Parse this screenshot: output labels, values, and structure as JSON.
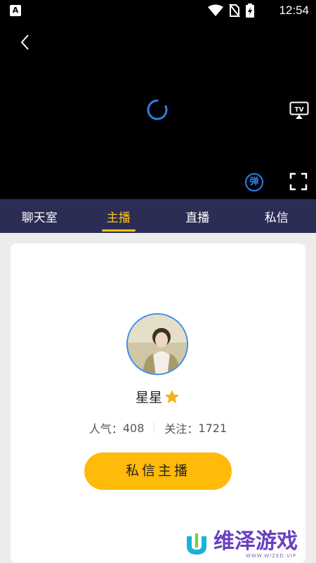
{
  "status_bar": {
    "app_icon_letter": "A",
    "time": "12:54"
  },
  "player": {
    "danmu_label": "弹",
    "tv_label": "TV"
  },
  "tabs": [
    {
      "label": "聊天室",
      "active": false
    },
    {
      "label": "主播",
      "active": true
    },
    {
      "label": "直播",
      "active": false
    },
    {
      "label": "私信",
      "active": false
    }
  ],
  "profile": {
    "name": "星星",
    "popularity_label": "人气：",
    "popularity_value": "408",
    "follow_label": "关注：",
    "follow_value": "1721",
    "message_button": "私信主播"
  },
  "watermark": {
    "text": "维泽游戏",
    "sub": "WWW.WIZED.VIP"
  },
  "colors": {
    "accent": "#ffc21a",
    "tab_bg": "#2c2d55",
    "button": "#ffba0a",
    "avatar_border": "#3d8df0",
    "spinner": "#2f7fe6"
  }
}
